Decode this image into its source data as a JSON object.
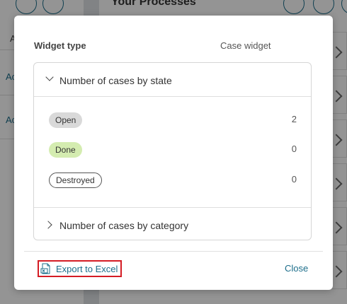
{
  "background": {
    "title": "Your Processes",
    "left_header_initial": "A",
    "left_items": [
      "Ac",
      "Ac"
    ]
  },
  "dialog": {
    "widget_type_label": "Widget type",
    "widget_type_value": "Case widget",
    "sections": {
      "state": {
        "title": "Number of cases by state",
        "expanded": true,
        "rows": [
          {
            "label": "Open",
            "count": "2"
          },
          {
            "label": "Done",
            "count": "0"
          },
          {
            "label": "Destroyed",
            "count": "0"
          }
        ]
      },
      "category": {
        "title": "Number of cases by category",
        "expanded": false
      }
    },
    "actions": {
      "export_label": "Export to Excel",
      "close_label": "Close"
    }
  },
  "colors": {
    "link": "#1b6d8a",
    "highlight_border": "#d41c24",
    "badge_open": "#d9d9d9",
    "badge_done": "#d4ecb0"
  },
  "icons": [
    "excel-export-icon",
    "chevron-down-icon",
    "chevron-right-icon",
    "filter-icon",
    "chart-icon",
    "expand-icon"
  ]
}
